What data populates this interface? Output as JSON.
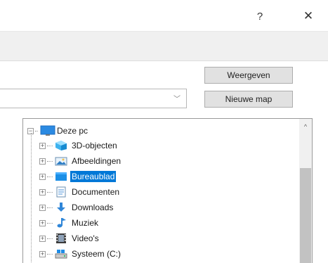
{
  "titlebar": {
    "help_label": "?",
    "close_label": "✕"
  },
  "buttons": {
    "show_label": "Weergeven",
    "new_folder_label": "Nieuwe map"
  },
  "combo": {
    "value": "",
    "arrow": "﹀"
  },
  "scrollbar": {
    "up_arrow": "^"
  },
  "tree": {
    "root": {
      "label": "Deze pc",
      "expander": "−",
      "icon": "this-pc-icon"
    },
    "items": [
      {
        "label": "3D-objecten",
        "icon": "3d-objects-icon",
        "expander": "+",
        "selected": false
      },
      {
        "label": "Afbeeldingen",
        "icon": "pictures-icon",
        "expander": "+",
        "selected": false
      },
      {
        "label": "Bureaublad",
        "icon": "desktop-icon",
        "expander": "+",
        "selected": true
      },
      {
        "label": "Documenten",
        "icon": "documents-icon",
        "expander": "+",
        "selected": false
      },
      {
        "label": "Downloads",
        "icon": "downloads-icon",
        "expander": "+",
        "selected": false
      },
      {
        "label": "Muziek",
        "icon": "music-icon",
        "expander": "+",
        "selected": false
      },
      {
        "label": "Video's",
        "icon": "videos-icon",
        "expander": "+",
        "selected": false
      },
      {
        "label": "Systeem (C:)",
        "icon": "drive-icon",
        "expander": "+",
        "selected": false
      }
    ]
  }
}
